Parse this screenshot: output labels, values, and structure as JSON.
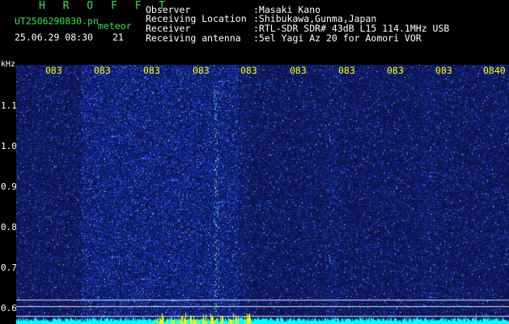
{
  "header": {
    "title": "H R O F F T",
    "filename": "UT2506290830.pn",
    "filename_suffix": "meteor",
    "datetime": "25.06.29 08:30",
    "count": "21",
    "meta": [
      {
        "label": "Observer",
        "value": ":Masaki Kano"
      },
      {
        "label": "Receiving Location",
        "value": ":Shibukawa,Gunma,Japan"
      },
      {
        "label": "Receiver",
        "value": ":RTL-SDR SDR# 43dB L15 114.1MHz USB"
      },
      {
        "label": "Receiving antenna",
        "value": ":5el Yagi Az 20 for Aomori VOR"
      }
    ]
  },
  "time_ticks": [
    "083",
    "083",
    "083",
    "083",
    "083",
    "083",
    "083",
    "083",
    "083",
    "0840"
  ],
  "y_axis": {
    "unit": "kHz",
    "labels": [
      "1.1",
      "1.0",
      "0.9",
      "0.8",
      "0.7",
      "0.6"
    ]
  },
  "colors": {
    "background": "#0d1550",
    "speckle": "#3060ff",
    "bright": "#b0e8ff",
    "baseline": "#00ffff",
    "meteor": "#ffff00",
    "header_green": "#33e04a",
    "tick_yellow": "#ffff00"
  }
}
